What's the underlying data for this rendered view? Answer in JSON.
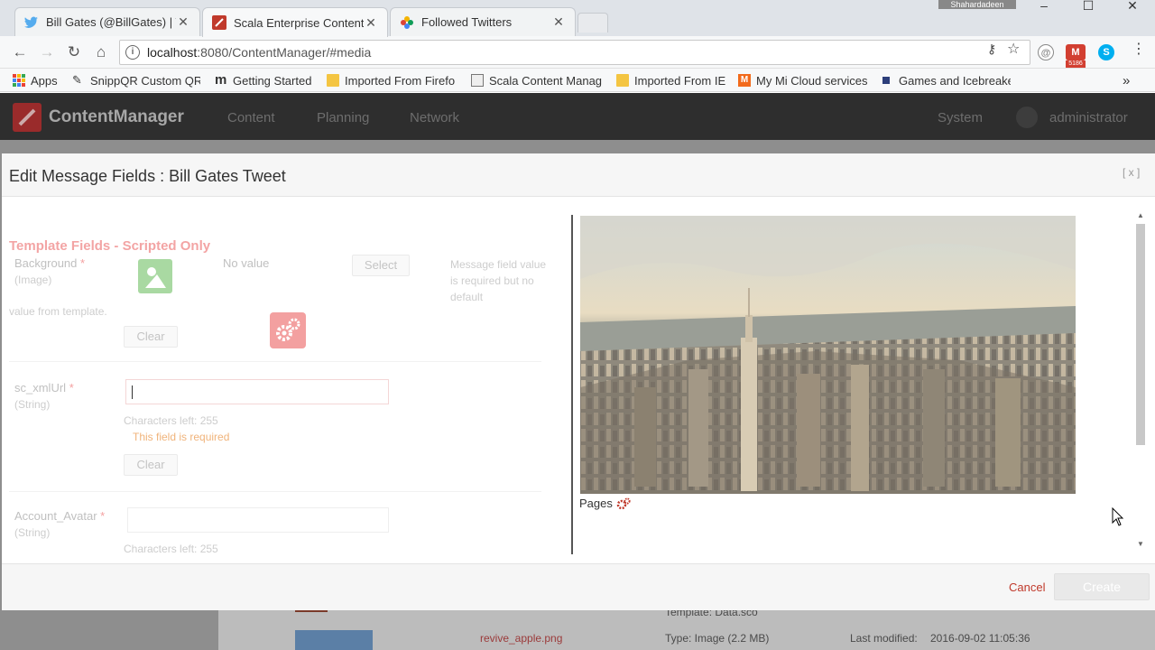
{
  "browser": {
    "tabs": [
      {
        "title": "Bill Gates (@BillGates) | T",
        "icon": "twitter-icon",
        "active": false
      },
      {
        "title": "Scala Enterprise Content",
        "icon": "scala-icon",
        "active": true
      },
      {
        "title": "Followed Twitters",
        "icon": "pinwheel-icon",
        "active": false
      }
    ],
    "window_user": "Shahardadeen",
    "url_host": "localhost",
    "url_path": ":8080/ContentManager/#media",
    "extension_badge": "5186",
    "bookmarks": [
      {
        "label": "Apps",
        "icon": "apps-grid-icon"
      },
      {
        "label": "SnippQR Custom QR",
        "icon": "snipp-icon"
      },
      {
        "label": "Getting Started",
        "icon": "m-icon"
      },
      {
        "label": "Imported From Firefo",
        "icon": "folder-icon"
      },
      {
        "label": "Scala Content Manag",
        "icon": "page-icon"
      },
      {
        "label": "Imported From IE",
        "icon": "folder-icon"
      },
      {
        "label": "My Mi Cloud services",
        "icon": "mi-icon"
      },
      {
        "label": "Games and Icebreake",
        "icon": "square-icon"
      }
    ],
    "bookmarks_more": "»"
  },
  "app": {
    "name": "ContentManager",
    "nav": [
      "Content",
      "Planning",
      "Network"
    ],
    "system": "System",
    "user": "administrator"
  },
  "background_list": {
    "template": "Template:  Data.sco",
    "filename": "revive_apple.png",
    "type": "Type:  Image (2.2 MB)",
    "modified_label": "Last modified:",
    "modified_value": "2016-09-02 11:05:36"
  },
  "modal": {
    "title": "Edit Message Fields : Bill Gates Tweet",
    "close": "[ x ]",
    "section_title": "Template Fields - Scripted Only",
    "background_field": {
      "label": "Background",
      "required": "*",
      "type": "(Image)",
      "value": "No value",
      "select": "Select",
      "note": "Message field value is required but no default",
      "note_cont": "value from template.",
      "clear": "Clear"
    },
    "xml_field": {
      "label": "sc_xmlUrl",
      "required": "*",
      "type": "(String)",
      "value": "",
      "chars_left": "Characters left: 255",
      "error": "This field is required",
      "clear": "Clear"
    },
    "avatar_field": {
      "label": "Account_Avatar",
      "required": "*",
      "type": "(String)",
      "value": "",
      "chars_left": "Characters left: 255"
    },
    "pages_label": "Pages",
    "cancel": "Cancel",
    "create": "Create"
  },
  "colors": {
    "accent_red": "#c0392b",
    "section_pink": "#f3a4a4",
    "error_orange": "#f0b37a",
    "header_dark": "#2e2e2e"
  }
}
